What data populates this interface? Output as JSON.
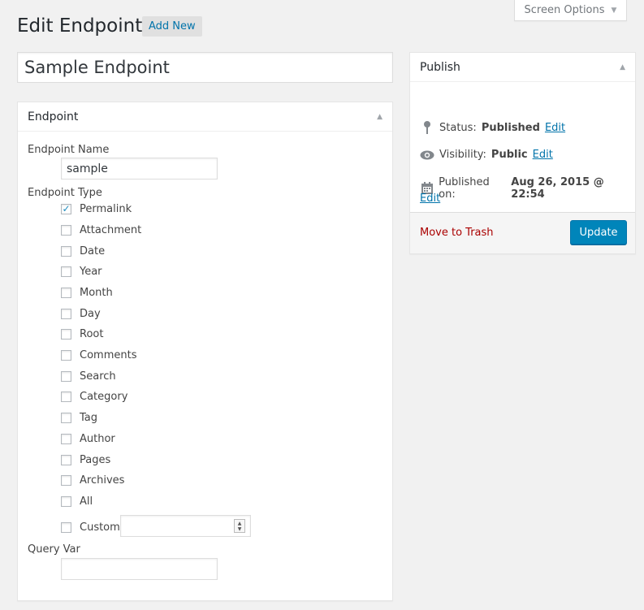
{
  "header": {
    "screen_options": "Screen Options",
    "title": "Edit Endpoint",
    "add_new": "Add New"
  },
  "post_title": "Sample Endpoint",
  "endpoint_box": {
    "heading": "Endpoint",
    "name_label": "Endpoint Name",
    "name_value": "sample",
    "type_label": "Endpoint Type",
    "types": [
      {
        "label": "Permalink",
        "checked": true
      },
      {
        "label": "Attachment",
        "checked": false
      },
      {
        "label": "Date",
        "checked": false
      },
      {
        "label": "Year",
        "checked": false
      },
      {
        "label": "Month",
        "checked": false
      },
      {
        "label": "Day",
        "checked": false
      },
      {
        "label": "Root",
        "checked": false
      },
      {
        "label": "Comments",
        "checked": false
      },
      {
        "label": "Search",
        "checked": false
      },
      {
        "label": "Category",
        "checked": false
      },
      {
        "label": "Tag",
        "checked": false
      },
      {
        "label": "Author",
        "checked": false
      },
      {
        "label": "Pages",
        "checked": false
      },
      {
        "label": "Archives",
        "checked": false
      },
      {
        "label": "All",
        "checked": false
      },
      {
        "label": "Custom",
        "checked": false
      }
    ],
    "custom_value": "",
    "query_var_label": "Query Var",
    "query_var_value": ""
  },
  "publish_box": {
    "heading": "Publish",
    "status_label": "Status:",
    "status_value": "Published",
    "visibility_label": "Visibility:",
    "visibility_value": "Public",
    "published_label": "Published on:",
    "published_value": "Aug 26, 2015 @ 22:54",
    "edit_label": "Edit",
    "trash": "Move to Trash",
    "update": "Update"
  },
  "icons": {
    "screen_options_toggle": "triangle-down-icon",
    "status": "pin-icon",
    "visibility": "eye-icon",
    "published_on": "calendar-icon",
    "box_toggle": "triangle-up-icon"
  },
  "colors": {
    "link": "#0073aa",
    "primary_button": "#0085ba",
    "trash": "#a00",
    "background": "#f1f1f1"
  }
}
